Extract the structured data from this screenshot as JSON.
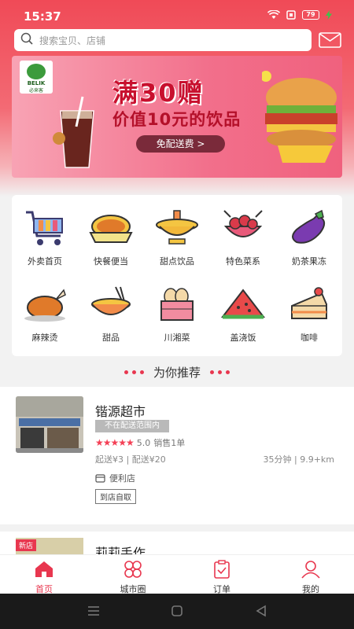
{
  "status": {
    "time": "15:37",
    "battery": "79"
  },
  "search": {
    "placeholder": "搜索宝贝、店铺"
  },
  "banner": {
    "brand": "BELIK",
    "brand_cn": "必来客",
    "title": "满30赠",
    "subtitle": "价值10元的饮品",
    "cta": "免配送费 >"
  },
  "categories": [
    {
      "label": "外卖首页",
      "icon": "cart-icon"
    },
    {
      "label": "快餐便当",
      "icon": "bento-icon"
    },
    {
      "label": "甜点饮品",
      "icon": "hotpot-icon"
    },
    {
      "label": "特色菜系",
      "icon": "crayfish-icon"
    },
    {
      "label": "奶茶果冻",
      "icon": "eggplant-icon"
    },
    {
      "label": "麻辣烫",
      "icon": "roast-chicken-icon"
    },
    {
      "label": "甜品",
      "icon": "noodle-bowl-icon"
    },
    {
      "label": "川湘菜",
      "icon": "bread-basket-icon"
    },
    {
      "label": "盖浇饭",
      "icon": "watermelon-icon"
    },
    {
      "label": "咖啡",
      "icon": "cake-icon"
    }
  ],
  "recommend": {
    "title": "为你推荐"
  },
  "store": {
    "name": "锴源超市",
    "badge": "不在配送范围内",
    "rating": "5.0",
    "sales": "销售1单",
    "fee": "起送¥3 | 配送¥20",
    "time": "35分钟 | 9.9+km",
    "type": "便利店",
    "pickup": "到店自取"
  },
  "store2": {
    "name": "莉莉手作",
    "tag": "新店"
  },
  "tabs": [
    {
      "label": "首页",
      "icon": "home-icon",
      "active": true
    },
    {
      "label": "城市圈",
      "icon": "city-circle-icon",
      "active": false
    },
    {
      "label": "订单",
      "icon": "order-icon",
      "active": false
    },
    {
      "label": "我的",
      "icon": "profile-icon",
      "active": false
    }
  ],
  "colors": {
    "brand": "#e8374f",
    "header": "#f04a57"
  }
}
